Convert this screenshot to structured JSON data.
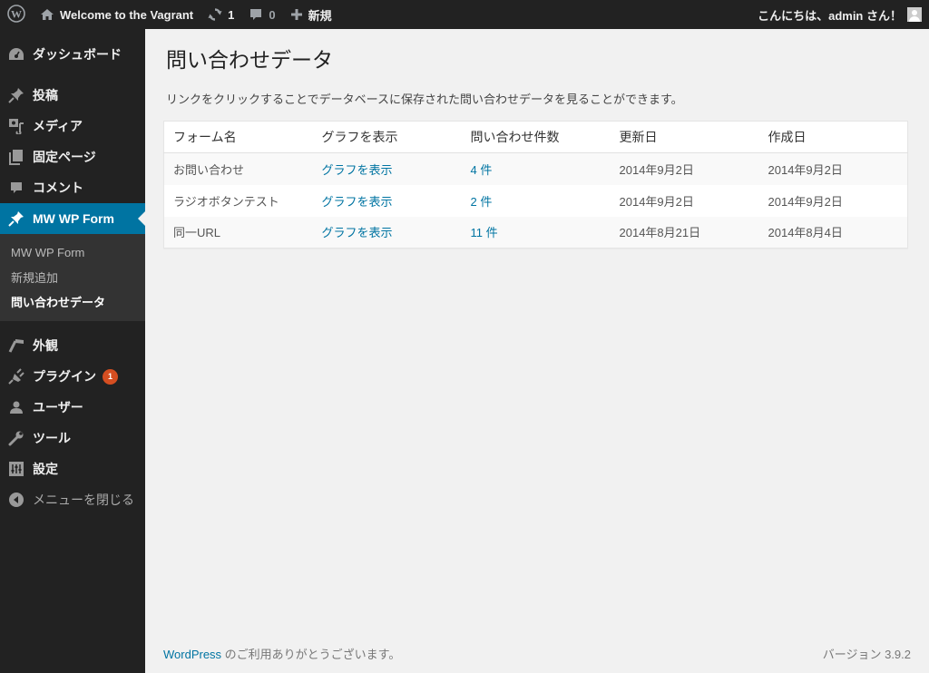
{
  "adminbar": {
    "site_name": "Welcome to the Vagrant",
    "updates_count": "1",
    "comments_count": "0",
    "new_label": "新規",
    "greeting": "こんにちは、admin さん！"
  },
  "sidebar": {
    "items": [
      {
        "label": "ダッシュボード",
        "icon": "dashboard-icon"
      },
      {
        "label": "投稿",
        "icon": "pin-icon"
      },
      {
        "label": "メディア",
        "icon": "media-icon"
      },
      {
        "label": "固定ページ",
        "icon": "pages-icon"
      },
      {
        "label": "コメント",
        "icon": "comment-icon"
      },
      {
        "label": "MW WP Form",
        "icon": "pin-icon"
      },
      {
        "label": "外観",
        "icon": "brush-icon"
      },
      {
        "label": "プラグイン",
        "icon": "plugin-icon",
        "badge": "1"
      },
      {
        "label": "ユーザー",
        "icon": "user-icon"
      },
      {
        "label": "ツール",
        "icon": "wrench-icon"
      },
      {
        "label": "設定",
        "icon": "settings-icon"
      },
      {
        "label": "メニューを閉じる",
        "icon": "collapse-icon"
      }
    ],
    "submenu": [
      {
        "label": "MW WP Form"
      },
      {
        "label": "新規追加"
      },
      {
        "label": "問い合わせデータ"
      }
    ]
  },
  "main": {
    "title": "問い合わせデータ",
    "description": "リンクをクリックすることでデータベースに保存された問い合わせデータを見ることができます。",
    "table": {
      "headers": [
        "フォーム名",
        "グラフを表示",
        "問い合わせ件数",
        "更新日",
        "作成日"
      ],
      "rows": [
        {
          "name": "お問い合わせ",
          "graph": "グラフを表示",
          "count": "4 件",
          "updated": "2014年9月2日",
          "created": "2014年9月2日"
        },
        {
          "name": "ラジオボタンテスト",
          "graph": "グラフを表示",
          "count": "2 件",
          "updated": "2014年9月2日",
          "created": "2014年9月2日"
        },
        {
          "name": "同一URL",
          "graph": "グラフを表示",
          "count": "11 件",
          "updated": "2014年8月21日",
          "created": "2014年8月4日"
        }
      ]
    }
  },
  "footer": {
    "wp_link": "WordPress",
    "thanks": " のご利用ありがとうございます。",
    "version": "バージョン 3.9.2"
  },
  "colors": {
    "accent": "#0074a2",
    "adminbar_bg": "#222222",
    "badge": "#d54e21"
  }
}
